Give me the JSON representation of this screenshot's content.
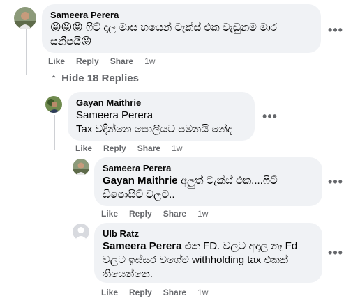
{
  "comment": {
    "author": "Sameera Perera",
    "emoji_prefix": "😝😝😝",
    "text_line1": " ෆිට් දාල මාස හයෙන් ටැක්ස් එක වැඩුනම මාර",
    "text_line2": "සනීපයි",
    "emoji_suffix": "😝",
    "like": "Like",
    "reply": "Reply",
    "share": "Share",
    "time": "1w"
  },
  "hide_replies": "Hide 18 Replies",
  "replies": [
    {
      "author": "Gayan Maithrie",
      "mention": "Sameera Perera",
      "text": "Tax වදින්නෙ පොලියට පමනයි නේද",
      "like": "Like",
      "reply": "Reply",
      "share": "Share",
      "time": "1w"
    },
    {
      "author": "Sameera Perera",
      "mention": "Gayan Maithrie",
      "text_line1": " අලුත් ටැක්ස් එක....ෆිට්",
      "text_line2": "ඩිපොසිට් වලට..",
      "like": "Like",
      "reply": "Reply",
      "share": "Share",
      "time": "1w"
    },
    {
      "author": "Ulb Ratz",
      "mention": "Sameera Perera",
      "text_line1": " එක FD. වලට අදාල නෑ Fd",
      "text_line2": "වලට ඉස්සර වගේම withholding tax එකක්",
      "text_line3": "තියෙන්නෙ.",
      "like": "Like",
      "reply": "Reply",
      "share": "Share",
      "time": "1w"
    }
  ],
  "more_label": "•••"
}
